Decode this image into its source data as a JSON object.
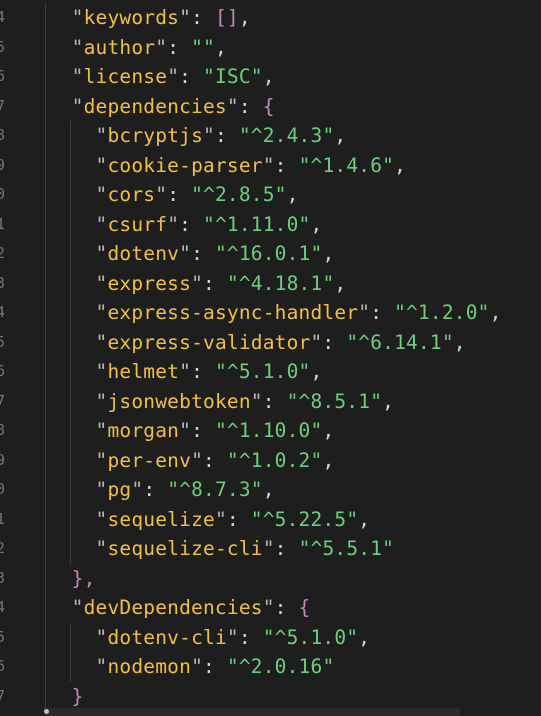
{
  "gutter_numbers": [
    "4",
    "5",
    "6",
    "7",
    "8",
    "9",
    "0",
    "1",
    "2",
    "3",
    "4",
    "5",
    "6",
    "7",
    "8",
    "9",
    "0",
    "1",
    "2",
    "3",
    "4",
    "5",
    "6",
    "7"
  ],
  "lines": [
    {
      "indent": 1,
      "key": "keywords",
      "sep": ": ",
      "value": "[]",
      "value_kind": "bracket",
      "tail": ","
    },
    {
      "indent": 1,
      "key": "author",
      "sep": ": ",
      "value": "\"\"",
      "value_kind": "string",
      "tail": ","
    },
    {
      "indent": 1,
      "key": "license",
      "sep": ": ",
      "value": "\"ISC\"",
      "value_kind": "string",
      "tail": ","
    },
    {
      "indent": 1,
      "key": "dependencies",
      "sep": ": ",
      "value": "{",
      "value_kind": "brace",
      "tail": ""
    },
    {
      "indent": 2,
      "key": "bcryptjs",
      "sep": ": ",
      "value": "\"^2.4.3\"",
      "value_kind": "string",
      "tail": ","
    },
    {
      "indent": 2,
      "key": "cookie-parser",
      "sep": ": ",
      "value": "\"^1.4.6\"",
      "value_kind": "string",
      "tail": ","
    },
    {
      "indent": 2,
      "key": "cors",
      "sep": ": ",
      "value": "\"^2.8.5\"",
      "value_kind": "string",
      "tail": ","
    },
    {
      "indent": 2,
      "key": "csurf",
      "sep": ": ",
      "value": "\"^1.11.0\"",
      "value_kind": "string",
      "tail": ","
    },
    {
      "indent": 2,
      "key": "dotenv",
      "sep": ": ",
      "value": "\"^16.0.1\"",
      "value_kind": "string",
      "tail": ","
    },
    {
      "indent": 2,
      "key": "express",
      "sep": ": ",
      "value": "\"^4.18.1\"",
      "value_kind": "string",
      "tail": ","
    },
    {
      "indent": 2,
      "key": "express-async-handler",
      "sep": ": ",
      "value": "\"^1.2.0\"",
      "value_kind": "string",
      "tail": ","
    },
    {
      "indent": 2,
      "key": "express-validator",
      "sep": ": ",
      "value": "\"^6.14.1\"",
      "value_kind": "string",
      "tail": ","
    },
    {
      "indent": 2,
      "key": "helmet",
      "sep": ": ",
      "value": "\"^5.1.0\"",
      "value_kind": "string",
      "tail": ","
    },
    {
      "indent": 2,
      "key": "jsonwebtoken",
      "sep": ": ",
      "value": "\"^8.5.1\"",
      "value_kind": "string",
      "tail": ","
    },
    {
      "indent": 2,
      "key": "morgan",
      "sep": ": ",
      "value": "\"^1.10.0\"",
      "value_kind": "string",
      "tail": ","
    },
    {
      "indent": 2,
      "key": "per-env",
      "sep": ": ",
      "value": "\"^1.0.2\"",
      "value_kind": "string",
      "tail": ","
    },
    {
      "indent": 2,
      "key": "pg",
      "sep": ": ",
      "value": "\"^8.7.3\"",
      "value_kind": "string",
      "tail": ","
    },
    {
      "indent": 2,
      "key": "sequelize",
      "sep": ": ",
      "value": "\"^5.22.5\"",
      "value_kind": "string",
      "tail": ","
    },
    {
      "indent": 2,
      "key": "sequelize-cli",
      "sep": ": ",
      "value": "\"^5.5.1\"",
      "value_kind": "string",
      "tail": ""
    },
    {
      "indent": 1,
      "key": "",
      "sep": "",
      "value": "},",
      "value_kind": "brace-close",
      "tail": ""
    },
    {
      "indent": 1,
      "key": "devDependencies",
      "sep": ": ",
      "value": "{",
      "value_kind": "brace2",
      "tail": ""
    },
    {
      "indent": 2,
      "key": "dotenv-cli",
      "sep": ": ",
      "value": "\"^5.1.0\"",
      "value_kind": "string",
      "tail": ","
    },
    {
      "indent": 2,
      "key": "nodemon",
      "sep": ": ",
      "value": "\"^2.0.16\"",
      "value_kind": "string",
      "tail": ""
    },
    {
      "indent": 1,
      "key": "",
      "sep": "",
      "value": "}",
      "value_kind": "brace2-close",
      "tail": ""
    }
  ],
  "colors": {
    "background": "#1e1e1e",
    "key": "#f0c045",
    "string": "#6ad17a",
    "brace_purple": "#c586c0",
    "brace_blue": "#179fff",
    "quote": "#b8b8b8",
    "gutter": "#6e7681"
  }
}
